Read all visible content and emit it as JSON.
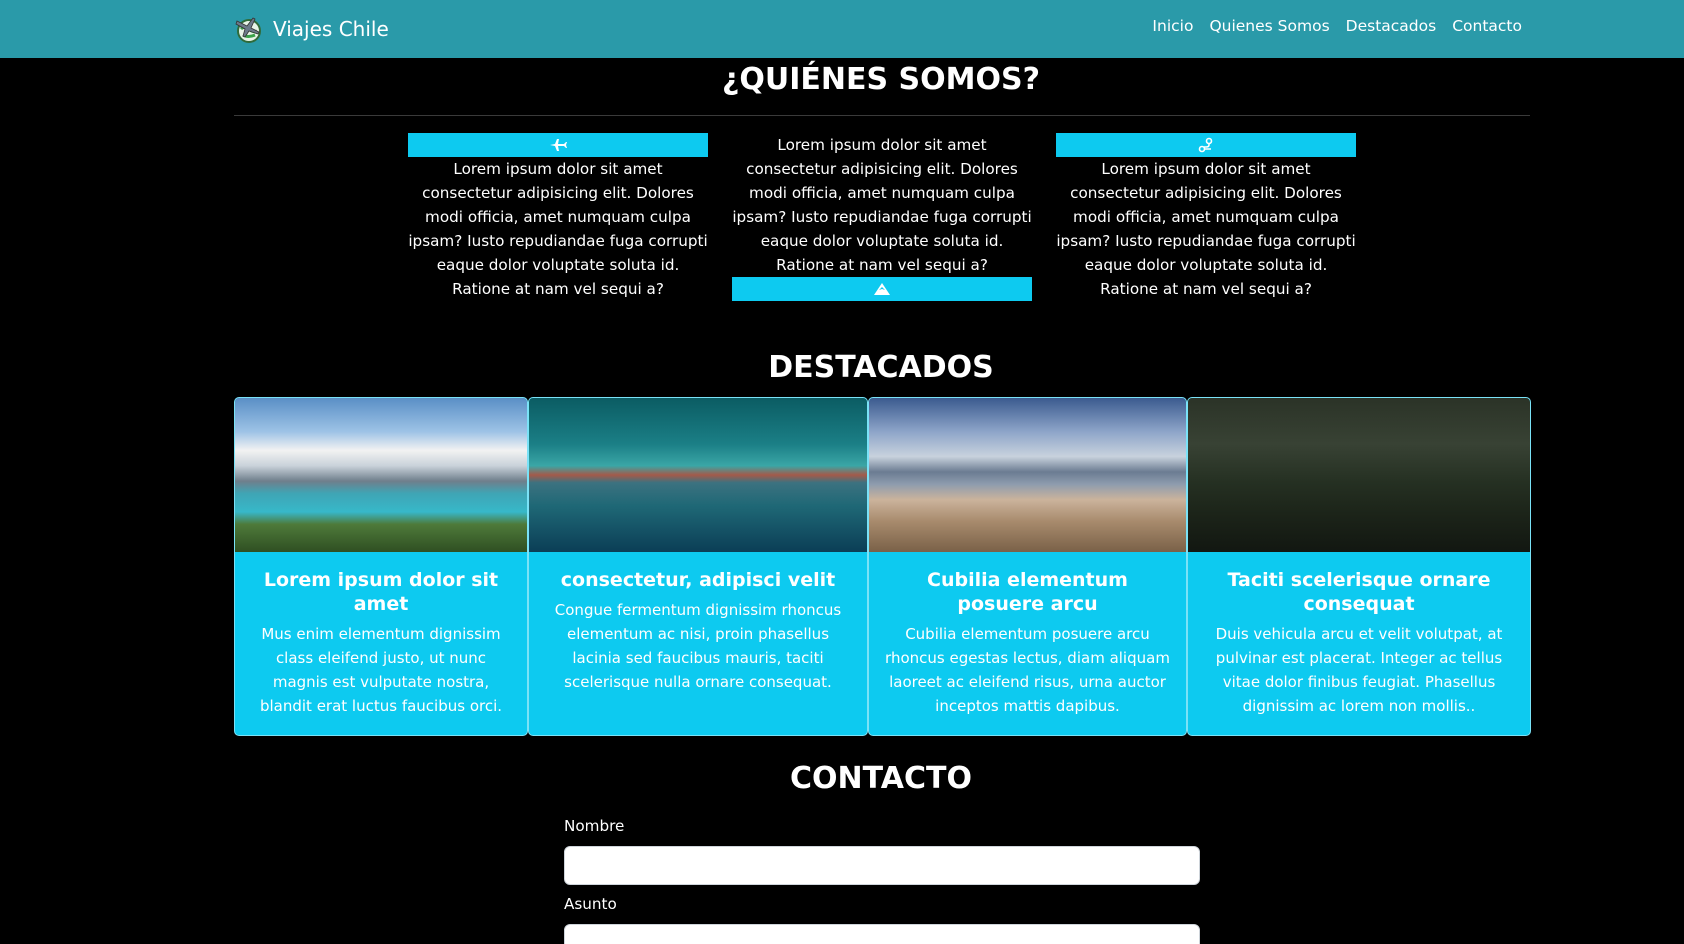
{
  "navbar": {
    "brand": "Viajes Chile",
    "links": [
      "Inicio",
      "Quienes Somos",
      "Destacados",
      "Contacto"
    ]
  },
  "quienes": {
    "title": "¿QUIÉNES SOMOS?",
    "columns": [
      {
        "icon": "plane-icon",
        "text": "Lorem ipsum dolor sit amet consectetur adipisicing elit. Dolores modi officia, amet numquam culpa ipsam? Iusto repudiandae fuga corrupti eaque dolor voluptate soluta id. Ratione at nam vel sequi a?"
      },
      {
        "icon": "mountain-icon",
        "text": "Lorem ipsum dolor sit amet consectetur adipisicing elit. Dolores modi officia, amet numquam culpa ipsam? Iusto repudiandae fuga corrupti eaque dolor voluptate soluta id. Ratione at nam vel sequi a?"
      },
      {
        "icon": "route-icon",
        "text": "Lorem ipsum dolor sit amet consectetur adipisicing elit. Dolores modi officia, amet numquam culpa ipsam? Iusto repudiandae fuga corrupti eaque dolor voluptate soluta id. Ratione at nam vel sequi a?"
      }
    ]
  },
  "destacados": {
    "title": "DESTACADOS",
    "cards": [
      {
        "title": "Lorem ipsum dolor sit amet",
        "text": "Mus enim elementum dignissim class eleifend justo, ut nunc magnis est vulputate nostra, blandit erat luctus faucibus orci."
      },
      {
        "title": "consectetur, adipisci velit",
        "text": "Congue fermentum dignissim rhoncus elementum ac nisi, proin phasellus lacinia sed faucibus mauris, taciti scelerisque nulla ornare consequat."
      },
      {
        "title": "Cubilia elementum posuere arcu",
        "text": "Cubilia elementum posuere arcu rhoncus egestas lectus, diam aliquam laoreet ac eleifend risus, urna auctor inceptos mattis dapibus."
      },
      {
        "title": "Taciti scelerisque ornare consequat",
        "text": "Duis vehicula arcu et velit volutpat, at pulvinar est placerat. Integer ac tellus vitae dolor finibus feugiat. Phasellus dignissim ac lorem non mollis.."
      }
    ]
  },
  "contacto": {
    "title": "CONTACTO",
    "fields": [
      {
        "label": "Nombre",
        "value": ""
      },
      {
        "label": "Asunto",
        "value": ""
      }
    ]
  },
  "colors": {
    "navbar": "#2a9aa9",
    "accent": "#0dcaf0",
    "background": "#000000"
  }
}
